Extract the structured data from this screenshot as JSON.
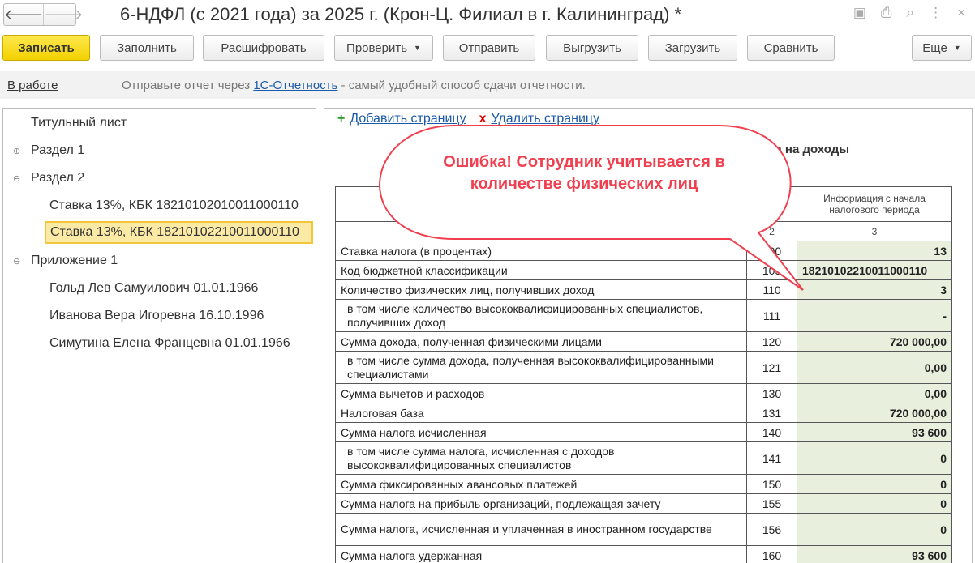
{
  "window": {
    "title": "6-НДФЛ (с 2021 года) за 2025 г. (Крон-Ц. Филиал в г. Калининград) *"
  },
  "toolbar": {
    "save": "Записать",
    "fill": "Заполнить",
    "decode": "Расшифровать",
    "check": "Проверить",
    "send": "Отправить",
    "export": "Выгрузить",
    "import": "Загрузить",
    "compare": "Сравнить",
    "more": "Еще"
  },
  "infobar": {
    "status": "В работе",
    "msg_before": "Отправьте отчет через",
    "link": "1С-Отчетность",
    "msg_after": "- самый удобный способ сдачи отчетности."
  },
  "tree": [
    {
      "label": "Титульный лист"
    },
    {
      "label": "Раздел 1",
      "exp": "⊕"
    },
    {
      "label": "Раздел 2",
      "exp": "⊖"
    },
    {
      "label": "Ставка 13%, КБК 18210102010011000110"
    },
    {
      "label": "Ставка 13%, КБК 18210102210011000110"
    },
    {
      "label": "Приложение 1",
      "exp": "⊖"
    },
    {
      "label": "Гольд Лев Самуилович 01.01.1966"
    },
    {
      "label": "Иванова Вера Игоревна 16.10.1996"
    },
    {
      "label": "Симутина Елена Францевна 01.01.1966"
    }
  ],
  "page": {
    "add": "Добавить страницу",
    "delete": "Удалить страницу",
    "heading": "ога на доходы"
  },
  "table": {
    "header": {
      "c3": "Информация с начала налогового периода",
      "n2": "2",
      "n3": "3"
    },
    "rows": [
      {
        "label": "Ставка налога (в процентах)",
        "code": "100",
        "value": "13"
      },
      {
        "label": "Код бюджетной классификации",
        "code": "105",
        "value": "18210102210011000110"
      },
      {
        "label": "Количество физических лиц, получивших доход",
        "code": "110",
        "value": "3"
      },
      {
        "label": "в том числе количество высококвалифицированных специалистов, получивших доход",
        "code": "111",
        "value": "-"
      },
      {
        "label": "Сумма дохода, полученная физическими лицами",
        "code": "120",
        "value": "720 000,00"
      },
      {
        "label": "в том числе сумма дохода, полученная высококвалифицированными специалистами",
        "code": "121",
        "value": "0,00"
      },
      {
        "label": "Сумма вычетов и расходов",
        "code": "130",
        "value": "0,00"
      },
      {
        "label": "Налоговая база",
        "code": "131",
        "value": "720 000,00"
      },
      {
        "label": "Сумма налога исчисленная",
        "code": "140",
        "value": "93 600"
      },
      {
        "label": "в том числе сумма налога, исчисленная с доходов высококвалифицированных специалистов",
        "code": "141",
        "value": "0"
      },
      {
        "label": "Сумма фиксированных авансовых платежей",
        "code": "150",
        "value": "0"
      },
      {
        "label": "Сумма налога на прибыль организаций, подлежащая зачету",
        "code": "155",
        "value": "0"
      },
      {
        "label": "Сумма налога, исчисленная и уплаченная в иностранном государстве",
        "code": "156",
        "value": "0"
      },
      {
        "label": "Сумма налога удержанная",
        "code": "160",
        "value": "93 600"
      }
    ]
  },
  "callout": {
    "text": "Ошибка! Сотрудник учитывается в количестве физических лиц",
    "color": "#f04050"
  }
}
